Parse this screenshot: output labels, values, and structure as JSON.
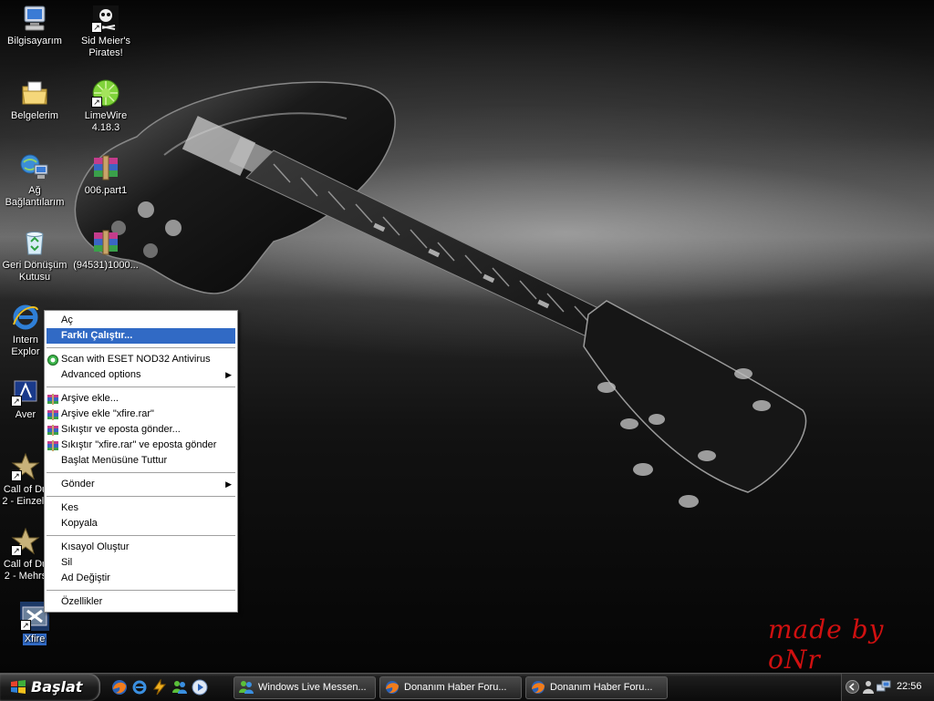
{
  "desktop": {
    "watermark": "made by oNr",
    "icons": [
      {
        "label": "Bilgisayarım",
        "icon": "my-computer-icon"
      },
      {
        "label": "Sid Meier's Pirates!",
        "icon": "pirates-game-icon"
      },
      {
        "label": "Belgelerim",
        "icon": "my-documents-icon"
      },
      {
        "label": "LimeWire 4.18.3",
        "icon": "limewire-icon"
      },
      {
        "label": "Ağ Bağlantılarım",
        "icon": "network-icon"
      },
      {
        "label": "006.part1",
        "icon": "winrar-archive-icon"
      },
      {
        "label": "Geri Dönüşüm Kutusu",
        "icon": "recycle-bin-icon"
      },
      {
        "label": "(94531)1000...",
        "icon": "winrar-archive-icon"
      },
      {
        "label": "Intern Explor",
        "icon": "internet-explorer-icon"
      },
      {
        "label": "Aver",
        "icon": "avermedia-icon"
      },
      {
        "label": "Call of Du 2 - Einzels",
        "icon": "call-of-duty-icon"
      },
      {
        "label": "Call of Du 2 - Mehrs",
        "icon": "call-of-duty-icon"
      },
      {
        "label": "Xfire",
        "icon": "xfire-icon"
      }
    ]
  },
  "context_menu": {
    "open": "Aç",
    "run_as": "Farklı Çalıştır...",
    "scan": "Scan with ESET NOD32 Antivirus",
    "advanced": "Advanced options",
    "add_archive": "Arşive ekle...",
    "add_archive_named": "Arşive ekle \"xfire.rar\"",
    "compress_email": "Sıkıştır ve eposta gönder...",
    "compress_email_named": "Sıkıştır \"xfire.rar\" ve eposta gönder",
    "pin_start": "Başlat Menüsüne Tuttur",
    "send_to": "Gönder",
    "cut": "Kes",
    "copy": "Kopyala",
    "create_shortcut": "Kısayol Oluştur",
    "delete": "Sil",
    "rename": "Ad Değiştir",
    "properties": "Özellikler"
  },
  "taskbar": {
    "start_label": "Başlat",
    "quick_launch": [
      "firefox-icon",
      "internet-explorer-icon",
      "winamp-icon",
      "messenger-icon",
      "media-player-icon"
    ],
    "tasks": [
      {
        "label": "Windows Live Messen...",
        "icon": "messenger-icon"
      },
      {
        "label": "Donanım Haber Foru...",
        "icon": "firefox-icon"
      },
      {
        "label": "Donanım Haber Foru...",
        "icon": "firefox-icon"
      }
    ],
    "clock": "22:56"
  }
}
